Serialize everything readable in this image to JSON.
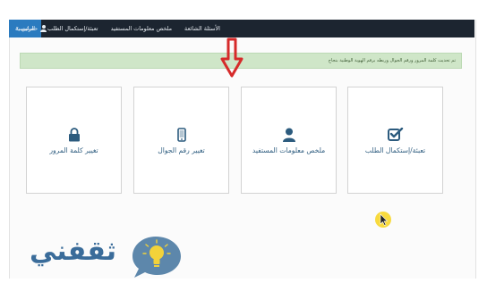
{
  "navbar": {
    "items": [
      {
        "label": "الرئيسية",
        "active": true
      },
      {
        "label": "تعبئة/إستكمال الطلب",
        "active": false
      },
      {
        "label": "ملخص معلومات المستفيد",
        "active": false
      },
      {
        "label": "الأسئلة الشائعة",
        "active": false
      }
    ],
    "account_label": "حسابي"
  },
  "alert": {
    "text": "تم تحديث كلمة المرور ورقم الجوال وربطه برقم الهوية الوطنية بنجاح"
  },
  "cards": [
    {
      "label": "تعبئة/إستكمال الطلب",
      "icon": "checkbox-icon"
    },
    {
      "label": "ملخص معلومات المستفيد",
      "icon": "user-icon"
    },
    {
      "label": "تغيير رقم الجوال",
      "icon": "mobile-icon"
    },
    {
      "label": "تغيير كلمة المرور",
      "icon": "lock-icon"
    }
  ],
  "watermark": {
    "text": "ثقفني"
  },
  "colors": {
    "navbar_bg": "#1c2530",
    "nav_active": "#2b7bbf",
    "alert_bg": "#cfe6c8",
    "card_text": "#2c5b7e",
    "arrow": "#d62a2a"
  }
}
